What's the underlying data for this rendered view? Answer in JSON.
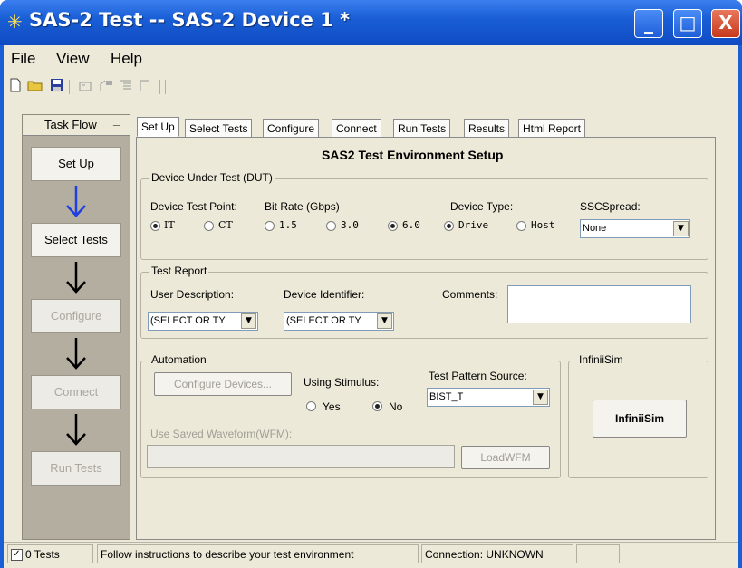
{
  "window": {
    "title": "SAS-2 Test -- SAS-2 Device 1 *",
    "minimize_symbol": "_",
    "maximize_symbol": "□",
    "close_symbol": "X"
  },
  "menu": {
    "items": [
      "File",
      "View",
      "Help"
    ]
  },
  "toolbar": {
    "icons": [
      "new-icon",
      "open-icon",
      "save-icon",
      "icon-1",
      "icon-2",
      "icon-3",
      "icon-4"
    ]
  },
  "taskflow": {
    "header": "Task Flow",
    "collapse_symbol": "_",
    "steps": [
      {
        "label": "Set Up",
        "enabled": true
      },
      {
        "label": "Select Tests",
        "enabled": true
      },
      {
        "label": "Configure",
        "enabled": false
      },
      {
        "label": "Connect",
        "enabled": false
      },
      {
        "label": "Run Tests",
        "enabled": false
      }
    ],
    "first_arrow_color": "#1f3fe0"
  },
  "tabs": [
    "Set Up",
    "Select Tests",
    "Configure",
    "Connect",
    "Run Tests",
    "Results",
    "Html Report"
  ],
  "active_tab": "Set Up",
  "setup": {
    "heading": "SAS2 Test Environment Setup",
    "dut": {
      "legend": "Device Under Test (DUT)",
      "test_point_label": "Device Test Point:",
      "bit_rate_label": "Bit Rate (Gbps)",
      "device_type_label": "Device Type:",
      "ssc_label": "SSCSpread:",
      "test_points": [
        {
          "label": "IT",
          "selected": true
        },
        {
          "label": "CT",
          "selected": false
        }
      ],
      "bit_rates": [
        {
          "label": "1.5",
          "selected": false
        },
        {
          "label": "3.0",
          "selected": false
        },
        {
          "label": "6.0",
          "selected": true
        }
      ],
      "device_types": [
        {
          "label": "Drive",
          "selected": true
        },
        {
          "label": "Host",
          "selected": false
        }
      ],
      "ssc_value": "None"
    },
    "report": {
      "legend": "Test Report",
      "user_desc_label": "User Description:",
      "device_id_label": "Device Identifier:",
      "comments_label": "Comments:",
      "user_desc_value": "(SELECT OR TY",
      "device_id_value": "(SELECT OR TY"
    },
    "automation": {
      "legend": "Automation",
      "configure_button": "Configure Devices...",
      "stimulus_label": "Using Stimulus:",
      "stimulus_options": [
        {
          "label": "Yes",
          "selected": false
        },
        {
          "label": "No",
          "selected": true
        }
      ],
      "pattern_label": "Test Pattern Source:",
      "pattern_value": "BIST_T",
      "wfm_label": "Use Saved Waveform(WFM):",
      "load_button": "LoadWFM"
    },
    "infiniisim": {
      "legend": "InfiniiSim",
      "button": "InfiniiSim"
    }
  },
  "status": {
    "checkbox_checked": true,
    "tests": "0 Tests",
    "message": "Follow instructions to describe your test environment",
    "connection": "Connection: UNKNOWN"
  }
}
